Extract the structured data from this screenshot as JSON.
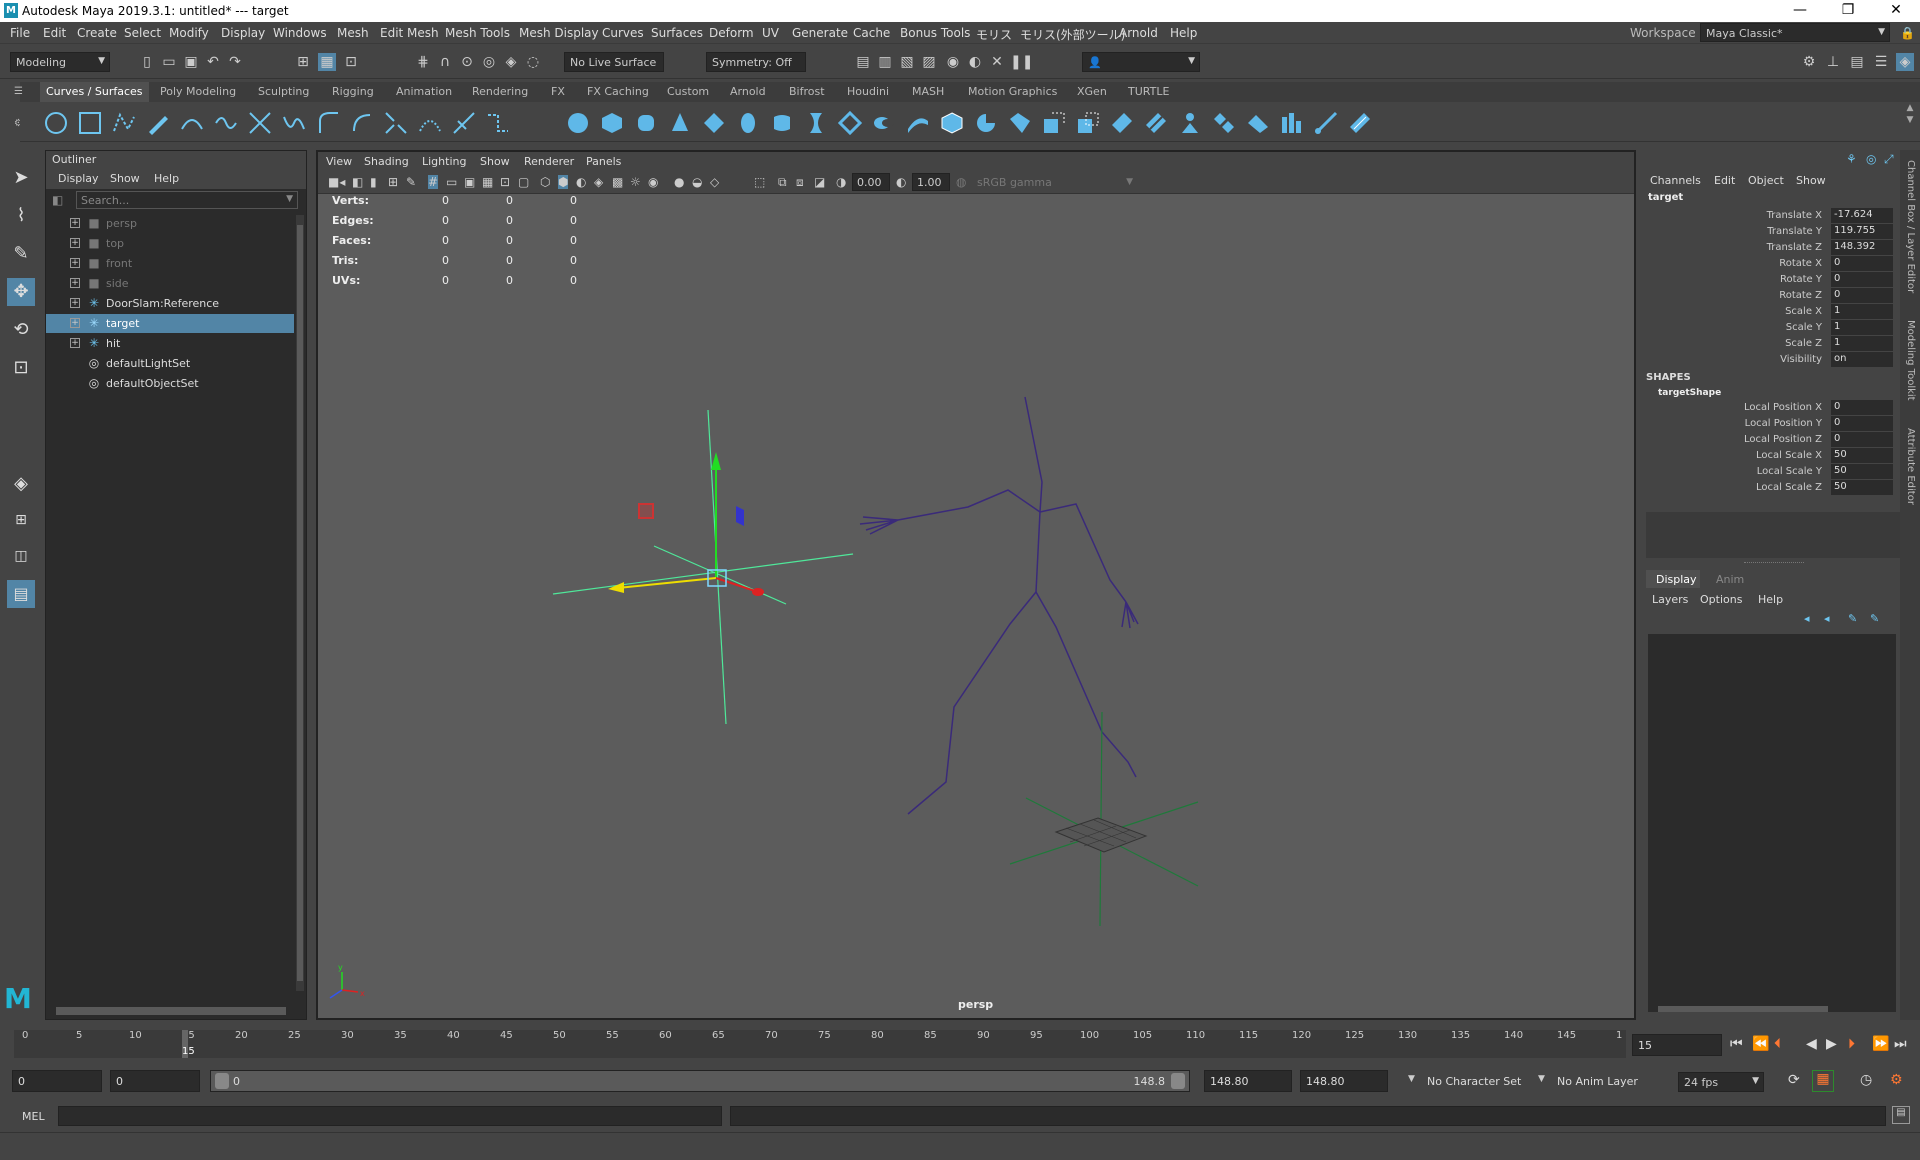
{
  "window": {
    "title": "Autodesk Maya 2019.3.1: untitled*   ---   target",
    "logo": "M",
    "minimize": "—",
    "maximize": "❐",
    "close": "✕"
  },
  "menubar": {
    "items": [
      "File",
      "Edit",
      "Create",
      "Select",
      "Modify",
      "Display",
      "Windows",
      "Mesh",
      "Edit Mesh",
      "Mesh Tools",
      "Mesh Display",
      "Curves",
      "Surfaces",
      "Deform",
      "UV",
      "Generate",
      "Cache",
      "Bonus Tools",
      "モリス",
      "モリス(外部ツール)",
      "Arnold",
      "Help"
    ],
    "workspace_label": "Workspace :",
    "workspace_value": "Maya Classic*"
  },
  "statusline": {
    "mode": "Modeling",
    "live_surface": "No Live Surface",
    "symmetry": "Symmetry: Off"
  },
  "shelf": {
    "tabs": [
      "Curves / Surfaces",
      "Poly Modeling",
      "Sculpting",
      "Rigging",
      "Animation",
      "Rendering",
      "FX",
      "FX Caching",
      "Custom",
      "Arnold",
      "Bifrost",
      "Houdini",
      "MASH",
      "Motion Graphics",
      "XGen",
      "TURTLE"
    ]
  },
  "outliner": {
    "title": "Outliner",
    "menu": [
      "Display",
      "Show",
      "Help"
    ],
    "search_placeholder": "Search...",
    "items": [
      {
        "label": "persp",
        "icon": "camera-icon"
      },
      {
        "label": "top",
        "icon": "camera-icon"
      },
      {
        "label": "front",
        "icon": "camera-icon"
      },
      {
        "label": "side",
        "icon": "camera-icon"
      },
      {
        "label": "DoorSlam:Reference",
        "icon": "joint-icon"
      },
      {
        "label": "target",
        "icon": "joint-icon"
      },
      {
        "label": "hit",
        "icon": "joint-icon"
      },
      {
        "label": "defaultLightSet",
        "icon": "set-icon"
      },
      {
        "label": "defaultObjectSet",
        "icon": "set-icon"
      }
    ]
  },
  "viewport": {
    "menu": [
      "View",
      "Shading",
      "Lighting",
      "Show",
      "Renderer",
      "Panels"
    ],
    "exposure": "0.00",
    "gamma": "1.00",
    "colorspace": "sRGB gamma",
    "hud": [
      {
        "label": "Verts:",
        "v1": "0",
        "v2": "0",
        "v3": "0"
      },
      {
        "label": "Edges:",
        "v1": "0",
        "v2": "0",
        "v3": "0"
      },
      {
        "label": "Faces:",
        "v1": "0",
        "v2": "0",
        "v3": "0"
      },
      {
        "label": "Tris:",
        "v1": "0",
        "v2": "0",
        "v3": "0"
      },
      {
        "label": "UVs:",
        "v1": "0",
        "v2": "0",
        "v3": "0"
      }
    ],
    "camera_label": "persp"
  },
  "channelbox": {
    "menu": [
      "Channels",
      "Edit",
      "Object",
      "Show"
    ],
    "object": "target",
    "channels": [
      {
        "label": "Translate X",
        "value": "-17.624"
      },
      {
        "label": "Translate Y",
        "value": "119.755"
      },
      {
        "label": "Translate Z",
        "value": "148.392"
      },
      {
        "label": "Rotate X",
        "value": "0"
      },
      {
        "label": "Rotate Y",
        "value": "0"
      },
      {
        "label": "Rotate Z",
        "value": "0"
      },
      {
        "label": "Scale X",
        "value": "1"
      },
      {
        "label": "Scale Y",
        "value": "1"
      },
      {
        "label": "Scale Z",
        "value": "1"
      },
      {
        "label": "Visibility",
        "value": "on"
      }
    ],
    "shapes_header": "SHAPES",
    "shape_name": "targetShape",
    "shape_channels": [
      {
        "label": "Local Position X",
        "value": "0"
      },
      {
        "label": "Local Position Y",
        "value": "0"
      },
      {
        "label": "Local Position Z",
        "value": "0"
      },
      {
        "label": "Local Scale X",
        "value": "50"
      },
      {
        "label": "Local Scale Y",
        "value": "50"
      },
      {
        "label": "Local Scale Z",
        "value": "50"
      }
    ]
  },
  "layereditor": {
    "tabs": [
      "Display",
      "Anim"
    ],
    "menu": [
      "Layers",
      "Options",
      "Help"
    ]
  },
  "sidetabs": [
    "Channel Box / Layer Editor",
    "Modeling Toolkit",
    "Attribute Editor"
  ],
  "timeslider": {
    "ticks": [
      "0",
      "5",
      "10",
      "15",
      "20",
      "25",
      "30",
      "35",
      "40",
      "45",
      "50",
      "55",
      "60",
      "65",
      "70",
      "75",
      "80",
      "85",
      "90",
      "95",
      "100",
      "105",
      "110",
      "115",
      "120",
      "125",
      "130",
      "135",
      "140",
      "145",
      "1"
    ],
    "current_frame": "15",
    "current_frame_field": "15"
  },
  "rangeslider": {
    "start": "0",
    "anim_start": "0",
    "range_start_label": "0",
    "range_end_label": "148.8",
    "anim_end": "148.80",
    "end": "148.80",
    "character_set": "No Character Set",
    "anim_layer": "No Anim Layer",
    "fps": "24 fps"
  },
  "cmdline": {
    "label": "MEL"
  }
}
